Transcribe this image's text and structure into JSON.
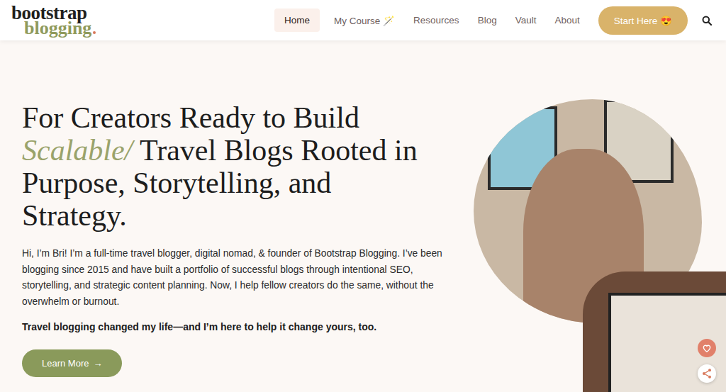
{
  "logo": {
    "top": "bootstrap",
    "bottom": "blogging"
  },
  "nav": [
    {
      "label": "Home",
      "selected": true
    },
    {
      "label": "My Course 🪄",
      "selected": false
    },
    {
      "label": "Resources",
      "selected": false
    },
    {
      "label": "Blog",
      "selected": false
    },
    {
      "label": "Vault",
      "selected": false
    },
    {
      "label": "About",
      "selected": false
    }
  ],
  "cta": "Start Here 😍",
  "hero": {
    "line1": "For Creators Ready to Build",
    "accent": "Scalable/",
    "line2": "Travel Blogs Rooted in",
    "line3": "Purpose, Storytelling, and",
    "line4": "Strategy.",
    "intro": "Hi, I’m Bri! I’m a full-time travel blogger, digital nomad, & founder of Bootstrap Blogging. I’ve been blogging since 2015 and have built a portfolio of successful blogs through intentional SEO, storytelling, and strategic content planning. Now, I help fellow creators do the same, without the overwhelm or burnout.",
    "tagline": "Travel blogging changed my life—and I’m here to help it change yours, too.",
    "button": "Learn More",
    "button_arrow": "→"
  }
}
